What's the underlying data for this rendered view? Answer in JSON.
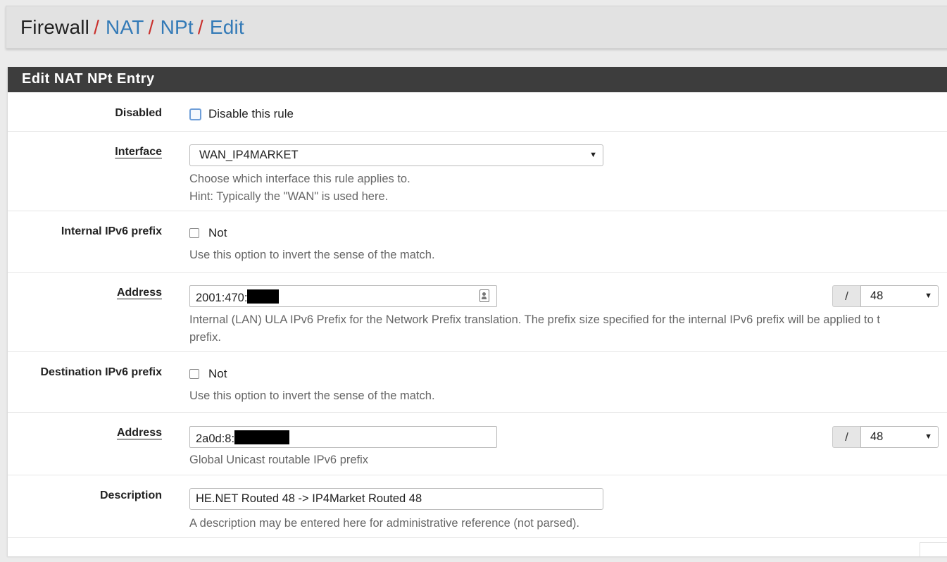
{
  "breadcrumb": {
    "root": "Firewall",
    "separator": "/",
    "items": [
      "NAT",
      "NPt",
      "Edit"
    ]
  },
  "panel": {
    "title": "Edit NAT NPt Entry"
  },
  "disabled": {
    "label": "Disabled",
    "checkbox_label": "Disable this rule",
    "checked": false
  },
  "interface": {
    "label": "Interface",
    "selected": "WAN_IP4MARKET",
    "help_line1": "Choose which interface this rule applies to.",
    "help_line2": "Hint: Typically the \"WAN\" is used here."
  },
  "internal_prefix": {
    "label": "Internal IPv6 prefix",
    "not_label": "Not",
    "help": "Use this option to invert the sense of the match.",
    "address_label": "Address",
    "address_value": "2001:470:",
    "slash": "/",
    "prefix_size": "48",
    "address_help_line1": "Internal (LAN) ULA IPv6 Prefix for the Network Prefix translation. The prefix size specified for the internal IPv6 prefix will be applied to t",
    "address_help_line2": "prefix."
  },
  "destination_prefix": {
    "label": "Destination IPv6 prefix",
    "not_label": "Not",
    "help": "Use this option to invert the sense of the match.",
    "address_label": "Address",
    "address_value": "2a0d:8:",
    "slash": "/",
    "prefix_size": "48",
    "address_help": "Global Unicast routable IPv6 prefix"
  },
  "description": {
    "label": "Description",
    "value": "HE.NET Routed 48 -> IP4Market Routed 48",
    "help": "A description may be entered here for administrative reference (not parsed)."
  },
  "colors": {
    "heading_bg": "#3d3d3d",
    "link": "#337ab7",
    "separator": "#c9302c"
  }
}
